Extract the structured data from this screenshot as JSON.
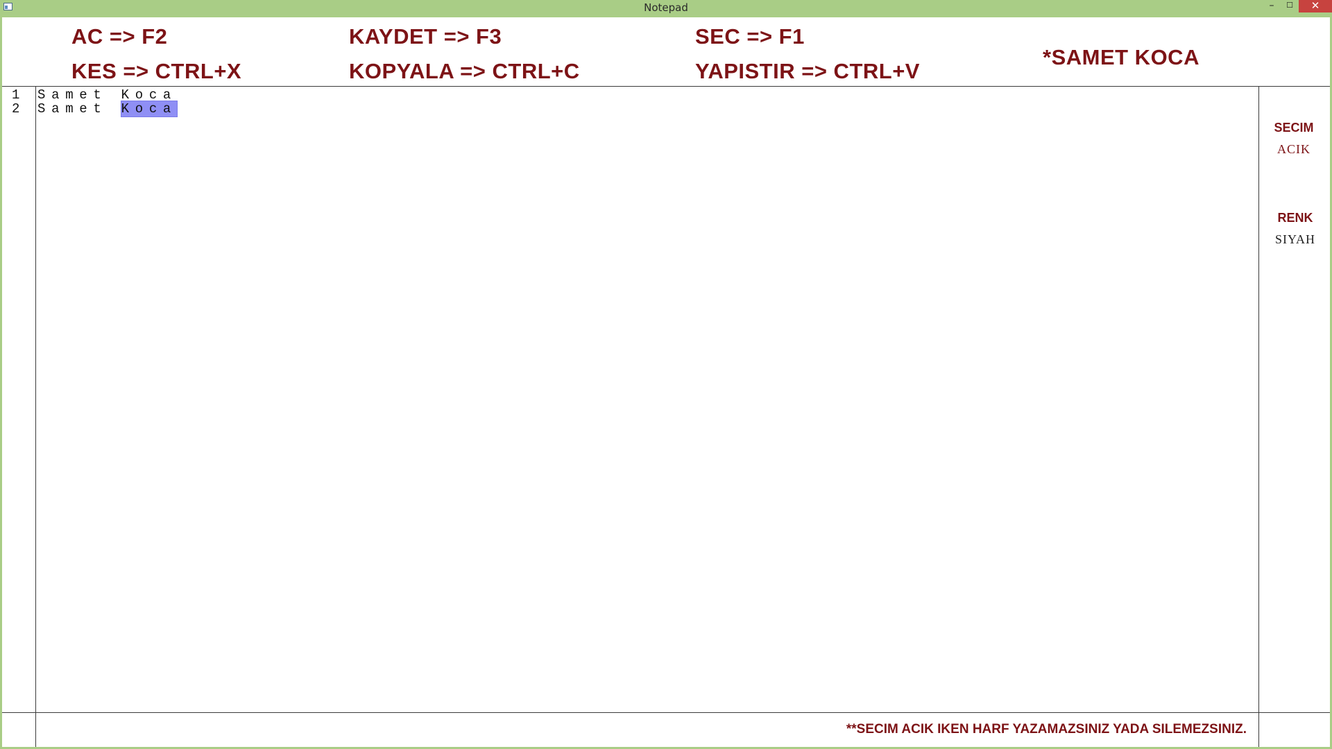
{
  "window": {
    "title": "Notepad",
    "minimize": "–",
    "maximize": "☐",
    "close": "✕"
  },
  "shortcuts": {
    "open": "AC => F2",
    "save": "KAYDET => F3",
    "select": "SEC => F1",
    "cut": "KES => CTRL+X",
    "copy": "KOPYALA => CTRL+C",
    "paste": "YAPISTIR => CTRL+V"
  },
  "author": "*SAMET KOCA",
  "editor": {
    "lines": [
      {
        "number": "1",
        "text": "Samet Koca",
        "selected": ""
      },
      {
        "number": "2",
        "text": "Samet ",
        "selected": "Koca"
      }
    ]
  },
  "sidebar": {
    "selection_label": "SECIM",
    "selection_value": "ACIK",
    "color_label": "RENK",
    "color_value": "SIYAH"
  },
  "footer": {
    "note": "**SECIM ACIK IKEN HARF YAZAMAZSINIZ YADA SILEMEZSINIZ."
  },
  "colors": {
    "accent": "#7d1316",
    "frame": "#a9cd86",
    "selection": "#8f8ff5",
    "close_button": "#c7433f"
  }
}
